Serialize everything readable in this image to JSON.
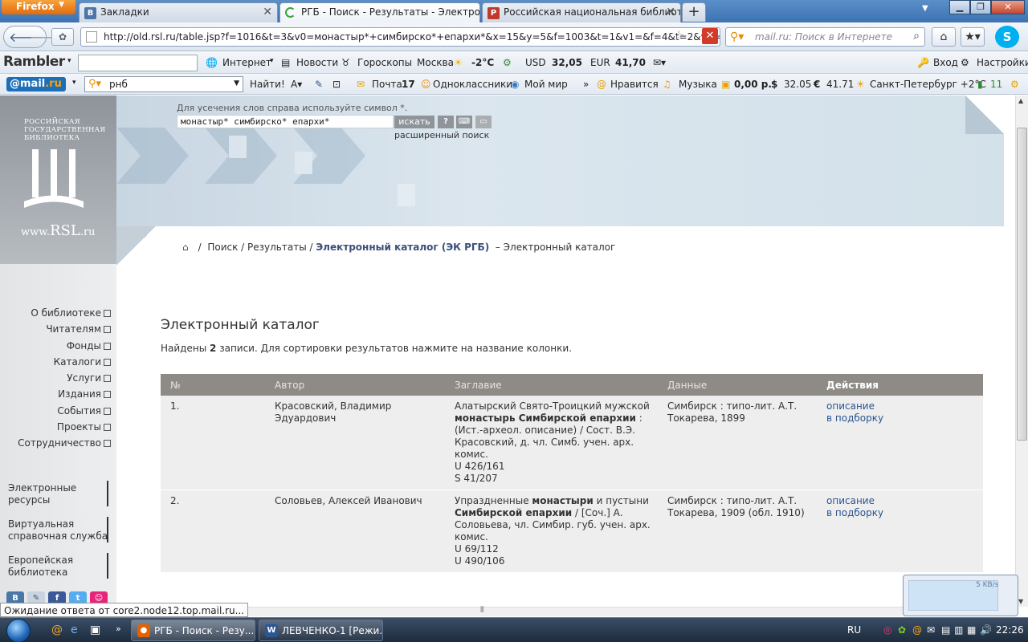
{
  "browser": {
    "menu_button": "Firefox",
    "tabs": [
      {
        "label": "Закладки",
        "favicon": "В"
      },
      {
        "label": "РГБ - Поиск - Результаты - Электро...",
        "favicon": "loading"
      },
      {
        "label": "Российская национальная библиот...",
        "favicon": "Р"
      }
    ],
    "url": "http://old.rsl.ru/table.jsp?f=1016&t=3&v0=монастыр*+симбирско*+епархи*&x=15&y=5&f=1003&t=1&v1=&f=4&t=2&v2=&f=21&",
    "search_placeholder": "mail.ru: Поиск в Интернете"
  },
  "rambler_bar": {
    "logo": "Rambler",
    "internet": "Интернет",
    "news": "Новости",
    "horoscopes": "Гороскопы",
    "city": "Москва",
    "temp": "-2°C",
    "usd_label": "USD",
    "usd_value": "32,05",
    "eur_label": "EUR",
    "eur_value": "41,70",
    "login": "Вход",
    "settings": "Настройки"
  },
  "mailru_bar": {
    "logo_prefix": "@mail",
    "logo_suffix": ".ru",
    "query": "рнб",
    "find": "Найти!",
    "mail_label": "Почта",
    "mail_count": "17",
    "odnoklassniki": "Одноклассники",
    "my_world": "Мой мир",
    "likes": "Нравится",
    "music": "Музыка",
    "money": "0,00 р.",
    "usd": "32.05",
    "eur": "41.71",
    "weather": "Санкт-Петербург +2°C",
    "traffic": "11"
  },
  "site": {
    "logo_lines": "Российская государственная библиотека",
    "logo_www": "www.",
    "logo_rsl": "RSL",
    "logo_ru": ".ru",
    "search_hint": "Для усечения слов справа используйте символ *.",
    "search_value": "монастыр* симбирско* епархи*",
    "search_button": "искать",
    "help_button": "?",
    "advanced_search": "расширенный поиск"
  },
  "breadcrumb": {
    "search": "Поиск",
    "results": "Результаты",
    "catalog_link": "Электронный каталог (ЭК РГБ)",
    "current": "Электронный каталог"
  },
  "nav_menu": [
    "О библиотеке",
    "Читателям",
    "Фонды",
    "Каталоги",
    "Услуги",
    "Издания",
    "События",
    "Проекты",
    "Сотрудничество"
  ],
  "left_links": [
    {
      "line1": "Электронные",
      "line2": "ресурсы"
    },
    {
      "line1": "Виртуальная",
      "line2": "справочная служба"
    },
    {
      "line1": "Европейская",
      "line2": "библиотека"
    }
  ],
  "main": {
    "title": "Электронный каталог",
    "found_prefix": "Найдены",
    "found_count": "2",
    "found_suffix": "записи. Для сортировки результатов нажмите на название колонки."
  },
  "table": {
    "headers": [
      "№",
      "Автор",
      "Заглавие",
      "Данные",
      "Действия"
    ],
    "rows": [
      {
        "num": "1.",
        "author": "Красовский, Владимир Эдуардович",
        "title_pre": "Алатырский Свято-Троицкий мужской",
        "title_bold": "монастырь Симбирской епархии",
        "title_post": ": (Ист.-археол. описание) / Сост. В.Э. Красовский, д. чл. Симб. учен. арх. комис.",
        "codes": [
          "U 426/161",
          "S 41/207"
        ],
        "data": "Симбирск : типо-лит. А.Т. Токарева, 1899",
        "action1": "описание",
        "action2": "в подборку"
      },
      {
        "num": "2.",
        "author": "Соловьев, Алексей Иванович",
        "title_pre": "Упраздненные",
        "title_bold": "монастыри",
        "title_mid": "и пустыни",
        "title_bold2": "Симбирской епархии",
        "title_post": "/ [Соч.] А. Соловьева, чл. Симбир. губ. учен. арх. комис.",
        "codes": [
          "U 69/112",
          "U 490/106"
        ],
        "data": "Симбирск : типо-лит. А.Т. Токарева, 1909 (обл. 1910)",
        "action1": "описание",
        "action2": "в подборку"
      }
    ]
  },
  "status": "Ожидание ответа от core2.node12.top.mail.ru...",
  "netwidget_rate": "5 KB/s",
  "taskbar": {
    "tasks": [
      "РГБ - Поиск - Резу...",
      "ЛЕВЧЕНКО-1 [Режи..."
    ],
    "lang": "RU",
    "time": "22:26"
  },
  "colors": {
    "table_header_bg": "#8e8a85",
    "row_bg": "#eeeeee",
    "link": "#2a5591",
    "breadcrumb_link": "#3b4f7a"
  }
}
